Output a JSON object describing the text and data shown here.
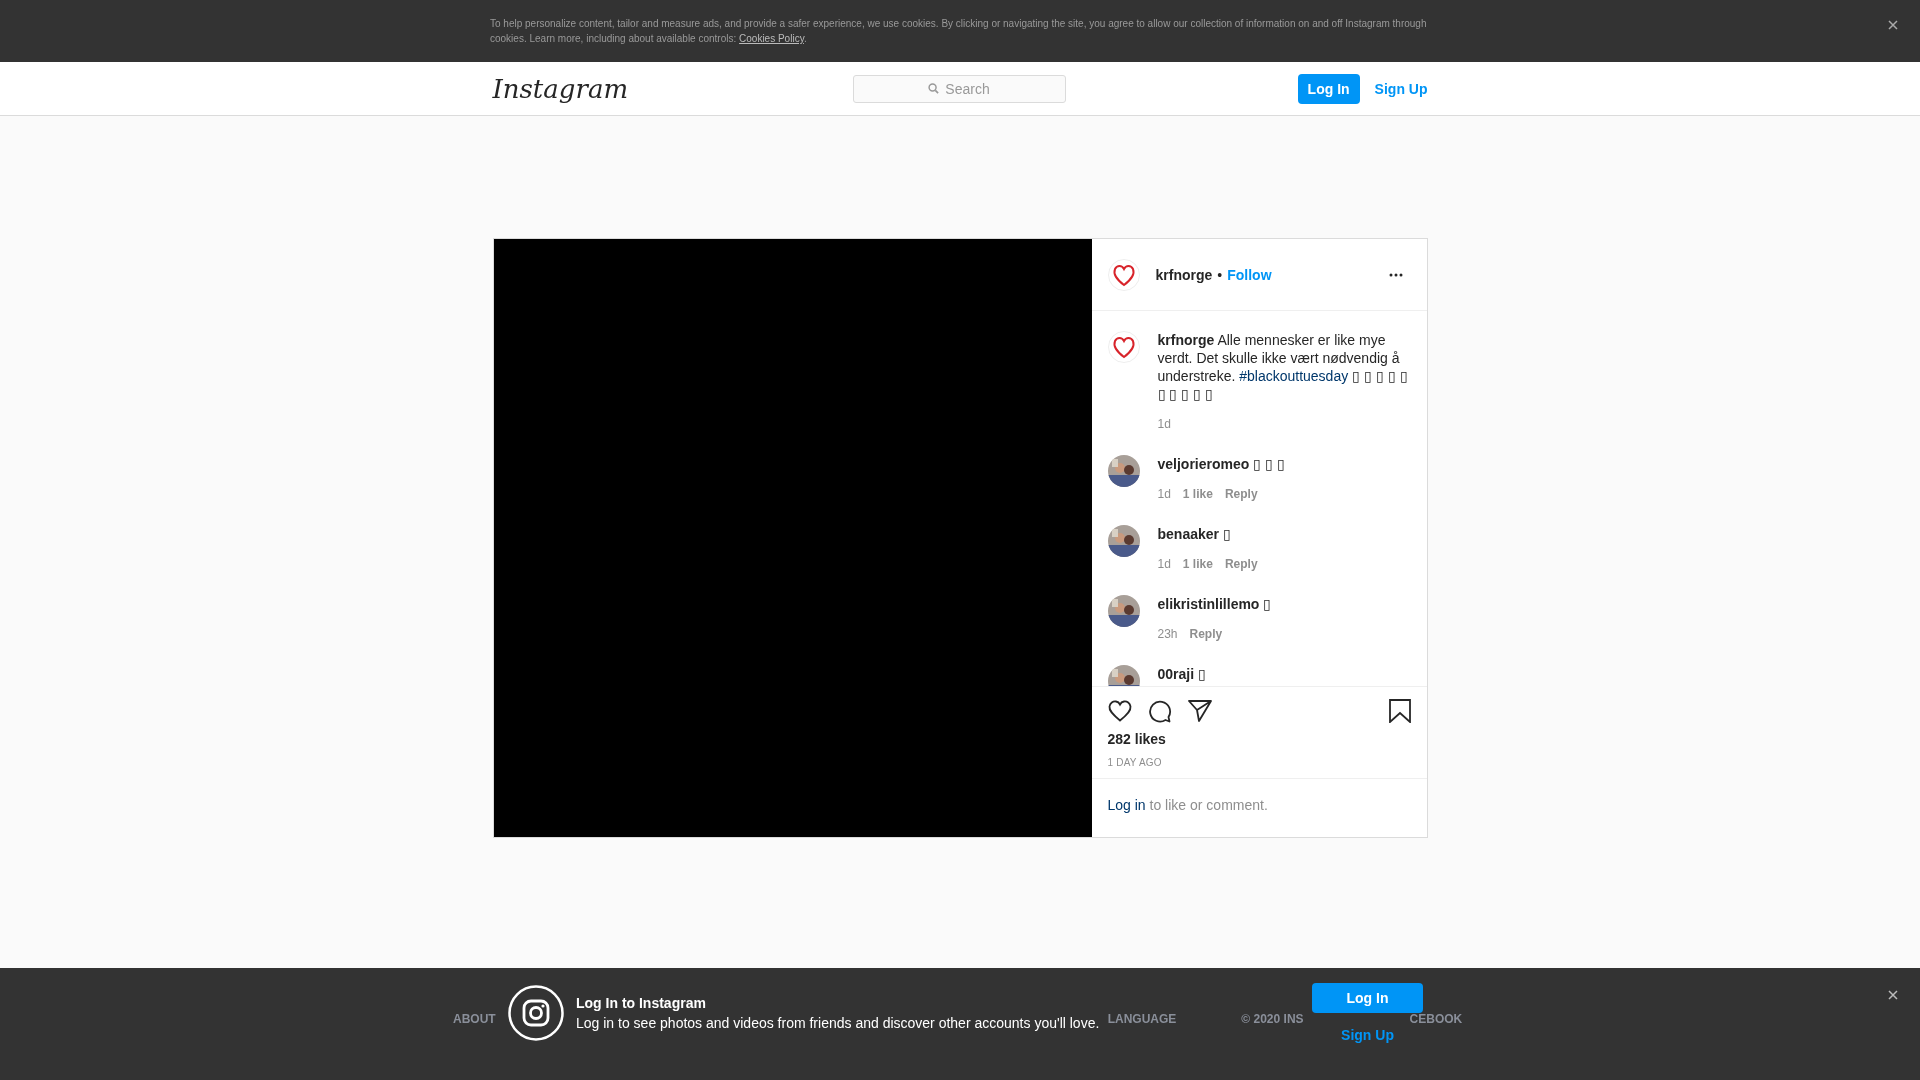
{
  "cookie_banner": {
    "text": "To help personalize content, tailor and measure ads, and provide a safer experience, we use cookies. By clicking or navigating the site, you agree to allow our collection of information on and off Instagram through cookies. Learn more, including about available controls: ",
    "link": "Cookies Policy",
    "after": "."
  },
  "header": {
    "logo": "Instagram",
    "search": {
      "placeholder": "Search"
    },
    "login_button": "Log In",
    "signup_link": "Sign Up"
  },
  "post": {
    "author": "krfnorge",
    "separator": "•",
    "follow": "Follow",
    "caption": {
      "user": "krfnorge",
      "text": "Alle mennesker er like mye verdt. Det skulle ikke vært nødvendig å understreke. ",
      "hashtag": "#blackouttuesday",
      "tail": " ▯ ▯ ▯ ▯ ▯ ▯ ▯ ▯ ▯ ▯",
      "time": "1d"
    },
    "comments": [
      {
        "user": "veljorieromeo",
        "text": "▯ ▯ ▯",
        "time": "1d",
        "likes": "1 like",
        "reply": "Reply"
      },
      {
        "user": "benaaker",
        "text": "▯",
        "time": "1d",
        "likes": "1 like",
        "reply": "Reply"
      },
      {
        "user": "elikristinlillemo",
        "text": "▯",
        "time": "23h",
        "reply": "Reply"
      },
      {
        "user": "00raji",
        "text": "▯"
      }
    ],
    "likes": "282 likes",
    "age": "1 DAY AGO",
    "login_link": "Log in",
    "login_text": " to like or comment."
  },
  "footer": {
    "links": [
      "ABOUT",
      "LANGUAGE"
    ],
    "copyright_start": "© 2020 INS",
    "copyright_end": "CEBOOK"
  },
  "login_bar": {
    "title": "Log In to Instagram",
    "text": "Log in to see photos and videos from friends and discover other accounts you'll love.",
    "login_button": "Log In",
    "signup_link": "Sign Up"
  }
}
